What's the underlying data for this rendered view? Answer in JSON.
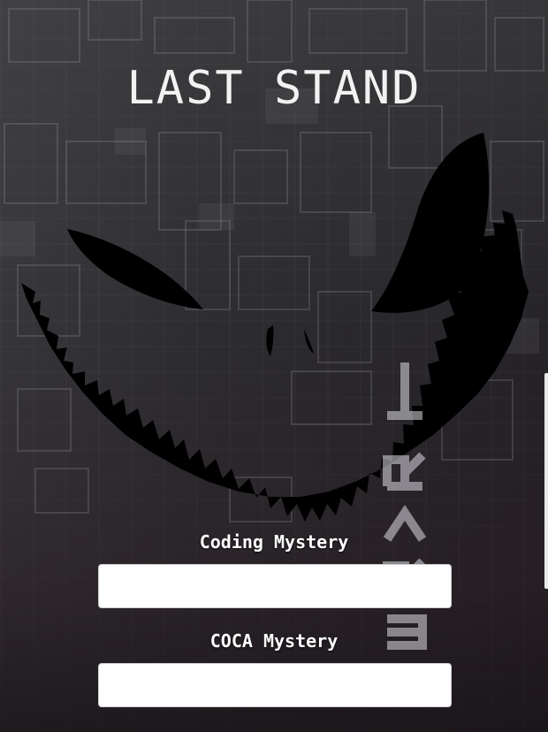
{
  "app": {
    "title": "LAST STAND"
  },
  "background": {
    "vertical_text": "ᛋSRVR",
    "accent_color": "#ffffff"
  },
  "form": {
    "fields": [
      {
        "label": "Coding Mystery",
        "value": "",
        "placeholder": ""
      },
      {
        "label": "COCA Mystery",
        "value": "",
        "placeholder": ""
      }
    ]
  },
  "colors": {
    "title": "#f2f2f2",
    "label": "#ffffff",
    "input_bg": "#ffffff",
    "face": "#000000"
  },
  "icons": {
    "face": "grinning-face-silhouette-icon"
  }
}
